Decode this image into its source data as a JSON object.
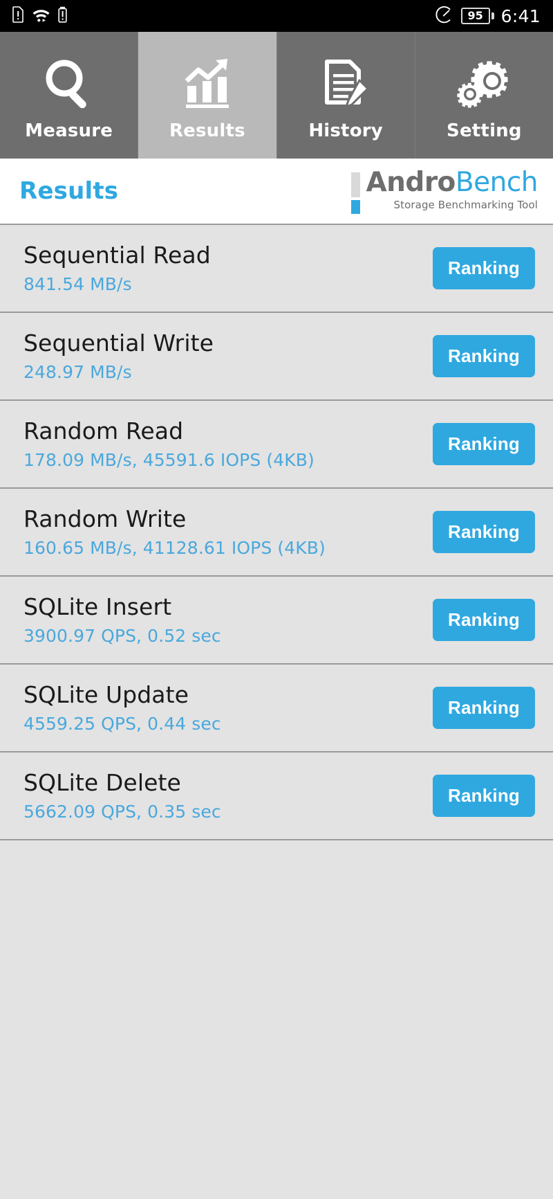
{
  "statusbar": {
    "time": "6:41",
    "battery_percent": "95",
    "icons": [
      "sim-alert-icon",
      "wifi-icon",
      "sim-alert-icon",
      "speedometer-icon",
      "battery-icon"
    ]
  },
  "tabs": [
    {
      "label": "Measure",
      "icon": "magnifier-icon",
      "active": false
    },
    {
      "label": "Results",
      "icon": "bar-chart-arrow-icon",
      "active": true
    },
    {
      "label": "History",
      "icon": "document-pencil-icon",
      "active": false
    },
    {
      "label": "Setting",
      "icon": "gears-icon",
      "active": false
    }
  ],
  "header": {
    "title": "Results",
    "logo_andro": "Andro",
    "logo_bench": "Bench",
    "logo_subtitle": "Storage Benchmarking Tool"
  },
  "colors": {
    "accent": "#2fa8e0",
    "value_text": "#4aa8dd",
    "tab_inactive": "#6e6e6e",
    "tab_active": "#b9b9b9",
    "list_bg": "#e3e3e3",
    "logo_gray": "#6d6d6d"
  },
  "results": [
    {
      "title": "Sequential Read",
      "value": "841.54 MB/s",
      "button": "Ranking"
    },
    {
      "title": "Sequential Write",
      "value": "248.97 MB/s",
      "button": "Ranking"
    },
    {
      "title": "Random Read",
      "value": "178.09 MB/s, 45591.6 IOPS (4KB)",
      "button": "Ranking"
    },
    {
      "title": "Random Write",
      "value": "160.65 MB/s, 41128.61 IOPS (4KB)",
      "button": "Ranking"
    },
    {
      "title": "SQLite Insert",
      "value": "3900.97 QPS, 0.52 sec",
      "button": "Ranking"
    },
    {
      "title": "SQLite Update",
      "value": "4559.25 QPS, 0.44 sec",
      "button": "Ranking"
    },
    {
      "title": "SQLite Delete",
      "value": "5662.09 QPS, 0.35 sec",
      "button": "Ranking"
    }
  ]
}
